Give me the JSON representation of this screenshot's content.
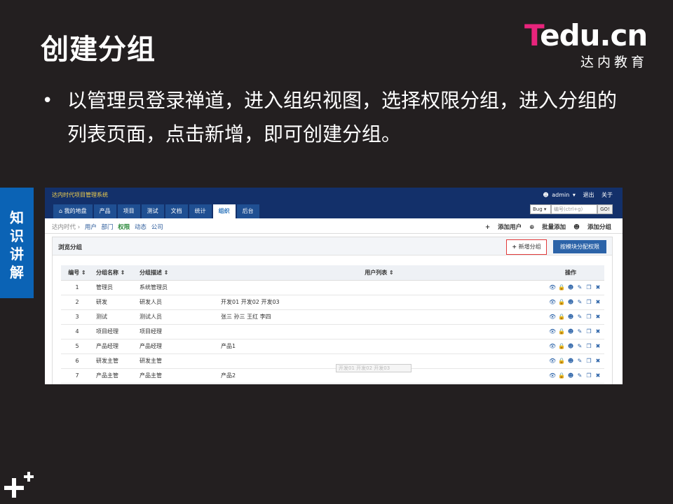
{
  "slide": {
    "title": "创建分组",
    "bullet": "以管理员登录禅道，进入组织视图，选择权限分组，进入分组的列表页面，点击新增，即可创建分组。",
    "side_tab": [
      "知",
      "识",
      "讲",
      "解"
    ]
  },
  "logo": {
    "main_t": "T",
    "main_rest": "edu.cn",
    "sub": "达内教育"
  },
  "app": {
    "name": "达内时代项目管理系统",
    "user": "admin",
    "logout": "退出",
    "about": "关于",
    "tabs": [
      {
        "label": "我的地盘",
        "active": false
      },
      {
        "label": "产品",
        "active": false
      },
      {
        "label": "项目",
        "active": false
      },
      {
        "label": "测试",
        "active": false
      },
      {
        "label": "文档",
        "active": false
      },
      {
        "label": "统计",
        "active": false
      },
      {
        "label": "组织",
        "active": true
      },
      {
        "label": "后台",
        "active": false
      }
    ],
    "search": {
      "type": "Bug",
      "placeholder": "编号(ctrl+g)",
      "go": "GO!"
    },
    "breadcrumb": {
      "root": "达内时代",
      "links": [
        "用户",
        "部门"
      ],
      "current": "权限",
      "more": [
        "动态",
        "公司"
      ]
    },
    "sub_actions": [
      "添加用户",
      "批量添加",
      "添加分组"
    ],
    "panel": {
      "title": "浏览分组",
      "new_button": "新增分组",
      "assign_button": "按模块分配权限"
    },
    "table": {
      "headers": [
        "编号",
        "分组名称",
        "分组描述",
        "用户列表",
        "操作"
      ],
      "rows": [
        {
          "id": "1",
          "name": "管理员",
          "desc": "系统管理员",
          "users": ""
        },
        {
          "id": "2",
          "name": "研发",
          "desc": "研发人员",
          "users": "开发01 开发02 开发03"
        },
        {
          "id": "3",
          "name": "测试",
          "desc": "测试人员",
          "users": "张三 孙三 王红 李四"
        },
        {
          "id": "4",
          "name": "项目经理",
          "desc": "项目经理",
          "users": ""
        },
        {
          "id": "5",
          "name": "产品经理",
          "desc": "产品经理",
          "users": "产品1"
        },
        {
          "id": "6",
          "name": "研发主管",
          "desc": "研发主管",
          "users": ""
        },
        {
          "id": "7",
          "name": "产品主管",
          "desc": "产品主管",
          "users": "产品2"
        }
      ],
      "op_icons": [
        "view-icon",
        "lock-icon",
        "group-icon",
        "edit-icon",
        "copy-icon",
        "delete-icon"
      ]
    },
    "tooltip": "开发01 开发02 开发03"
  }
}
